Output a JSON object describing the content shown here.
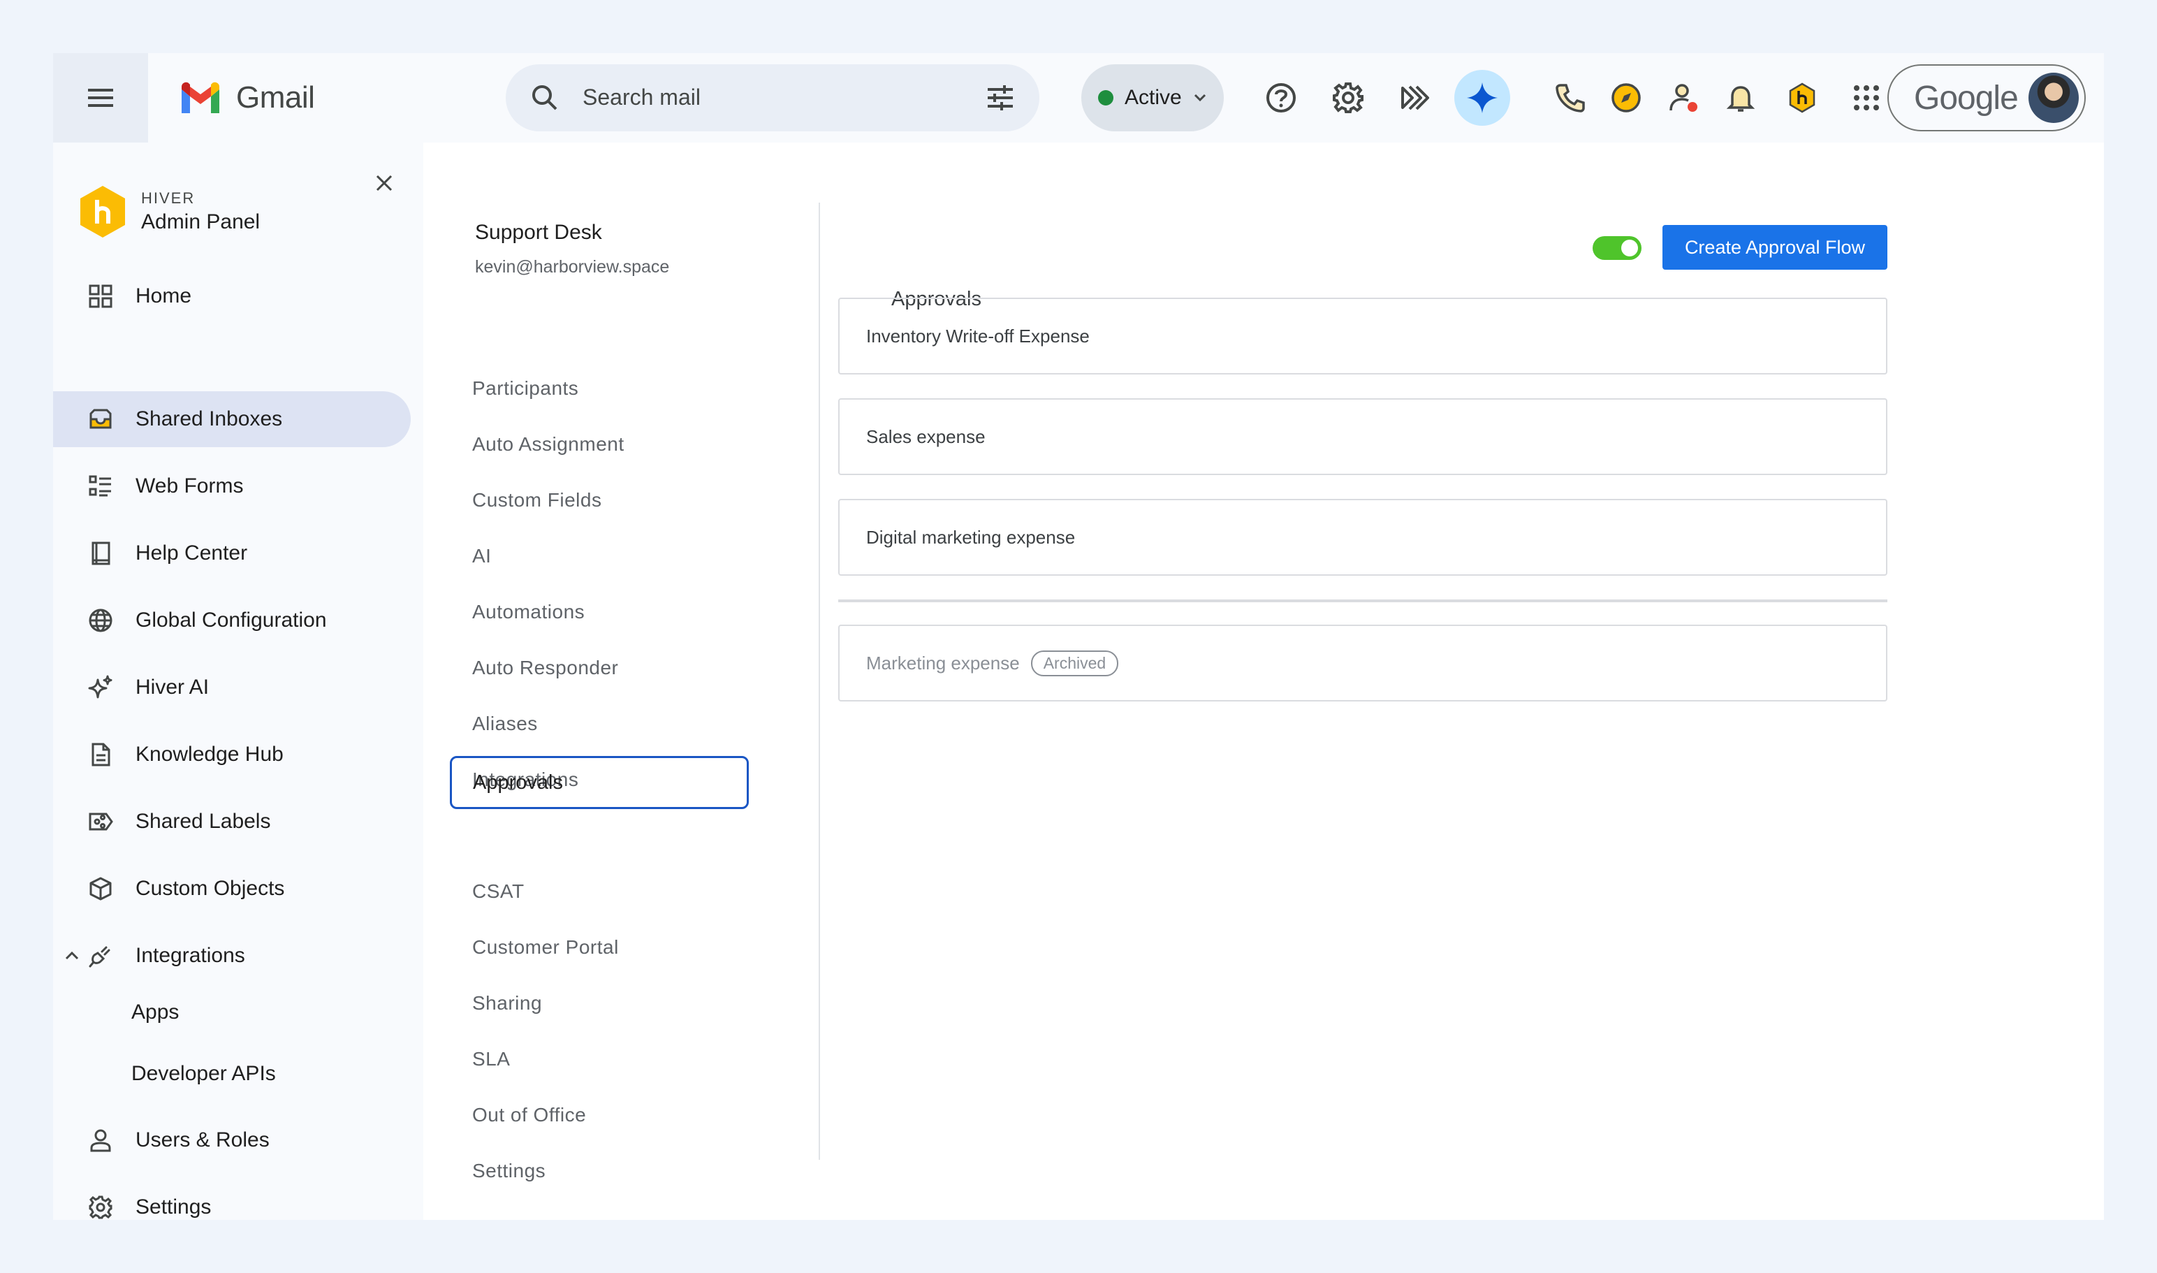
{
  "app": {
    "name": "Gmail"
  },
  "search": {
    "placeholder": "Search mail"
  },
  "status": {
    "label": "Active",
    "color": "#1e8e3e"
  },
  "topbar_icons": [
    "help-icon",
    "settings-gear-icon",
    "hiver-icon",
    "gemini-icon",
    "phone-icon",
    "compass-icon",
    "contact-status-icon",
    "notification-bell-icon",
    "hiver-extension-icon",
    "apps-grid-icon"
  ],
  "account": {
    "label": "Google"
  },
  "sidebar": {
    "brand_sub": "HIVER",
    "brand_title": "Admin Panel",
    "items": [
      {
        "label": "Home",
        "icon": "grid-icon"
      },
      {
        "label": "Shared Inboxes",
        "icon": "inbox-icon",
        "selected": true
      },
      {
        "label": "Web Forms",
        "icon": "form-list-icon"
      },
      {
        "label": "Help Center",
        "icon": "book-icon"
      },
      {
        "label": "Global Configuration",
        "icon": "globe-icon"
      },
      {
        "label": "Hiver AI",
        "icon": "sparkle-icon"
      },
      {
        "label": "Knowledge Hub",
        "icon": "document-icon"
      },
      {
        "label": "Shared Labels",
        "icon": "label-share-icon"
      },
      {
        "label": "Custom Objects",
        "icon": "cube-icon"
      },
      {
        "label": "Integrations",
        "icon": "plug-icon",
        "expanded": true
      },
      {
        "label": "Users & Roles",
        "icon": "user-icon"
      },
      {
        "label": "Settings",
        "icon": "gear-icon"
      }
    ],
    "integration_subitems": [
      "Apps",
      "Developer APIs"
    ]
  },
  "inbox": {
    "name": "Support Desk",
    "email": "kevin@harborview.space",
    "subnav": [
      "Participants",
      "Auto Assignment",
      "Custom Fields",
      "AI",
      "Automations",
      "Auto Responder",
      "Aliases",
      "Integrations",
      "Approvals",
      "CSAT",
      "Customer Portal",
      "Sharing",
      "SLA",
      "Out of Office",
      "Settings"
    ],
    "selected_subnav": "Approvals"
  },
  "approvals": {
    "title": "Approvals",
    "enabled": true,
    "create_label": "Create Approval Flow",
    "flows": [
      "Inventory Write-off Expense",
      "Sales expense",
      "Digital marketing expense"
    ],
    "archived_flows": [
      {
        "name": "Marketing expense",
        "badge": "Archived"
      }
    ]
  },
  "colors": {
    "accent": "#1a73e8",
    "toggle_on": "#4fc42b",
    "selected_nav": "#dde3f3",
    "hiver_yellow": "#fbbc04"
  }
}
